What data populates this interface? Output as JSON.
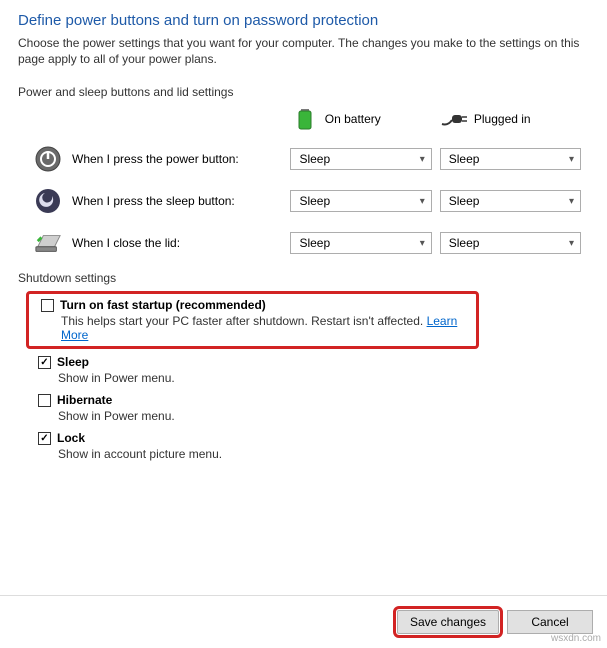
{
  "title": "Define power buttons and turn on password protection",
  "subtitle": "Choose the power settings that you want for your computer. The changes you make to the settings on this page apply to all of your power plans.",
  "section_label": "Power and sleep buttons and lid settings",
  "headers": {
    "battery": "On battery",
    "plugged": "Plugged in"
  },
  "rows": {
    "power": {
      "label": "When I press the power button:",
      "battery": "Sleep",
      "plugged": "Sleep"
    },
    "sleep": {
      "label": "When I press the sleep button:",
      "battery": "Sleep",
      "plugged": "Sleep"
    },
    "lid": {
      "label": "When I close the lid:",
      "battery": "Sleep",
      "plugged": "Sleep"
    }
  },
  "shutdown": {
    "section_label": "Shutdown settings",
    "fast": {
      "title": "Turn on fast startup (recommended)",
      "desc": "This helps start your PC faster after shutdown. Restart isn't affected.",
      "learn": "Learn More",
      "checked": false
    },
    "sleep": {
      "title": "Sleep",
      "desc": "Show in Power menu.",
      "checked": true
    },
    "hibernate": {
      "title": "Hibernate",
      "desc": "Show in Power menu.",
      "checked": false
    },
    "lock": {
      "title": "Lock",
      "desc": "Show in account picture menu.",
      "checked": true
    }
  },
  "buttons": {
    "save": "Save changes",
    "cancel": "Cancel"
  },
  "watermark": "wsxdn.com"
}
